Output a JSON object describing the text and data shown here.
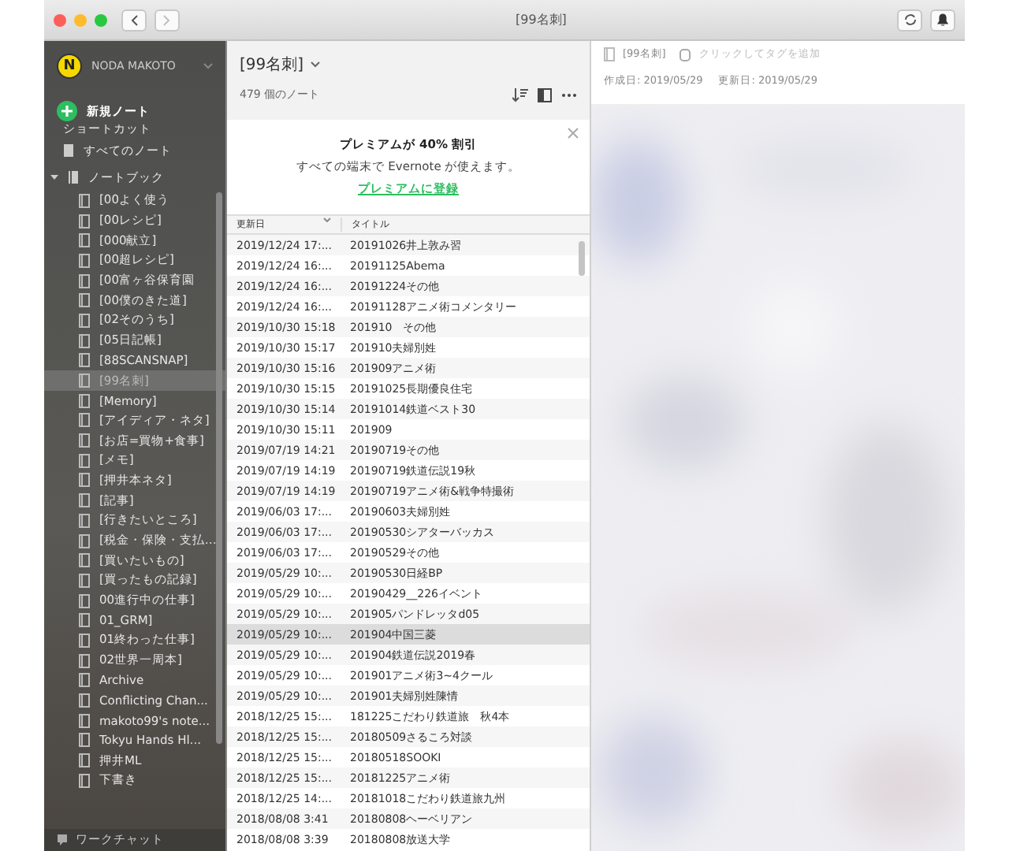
{
  "window": {
    "title": "[99名刺]",
    "back": {
      "disabled": false
    },
    "forward": {
      "disabled": true
    }
  },
  "sidebar": {
    "account": {
      "initial": "N",
      "name": "NODA MAKOTO"
    },
    "new_note": "新規ノート",
    "shortcuts": "ショートカット",
    "all_notes": "すべてのノート",
    "notebooks": {
      "label": "ノートブック",
      "expanded": true,
      "children": [
        {
          "label": "[00よく使う",
          "selected": false
        },
        {
          "label": "[00レシピ]",
          "selected": false
        },
        {
          "label": "[000献立]",
          "selected": false
        },
        {
          "label": "[00超レシピ]",
          "selected": false
        },
        {
          "label": "[00富ヶ谷保育園",
          "selected": false
        },
        {
          "label": "[00僕のきた道]",
          "selected": false
        },
        {
          "label": "[02そのうち]",
          "selected": false
        },
        {
          "label": "[05日記帳]",
          "selected": false
        },
        {
          "label": "[88SCANSNAP]",
          "selected": false
        },
        {
          "label": "[99名刺]",
          "selected": true
        },
        {
          "label": "[Memory]",
          "selected": false
        },
        {
          "label": "[アイディア・ネタ]",
          "selected": false
        },
        {
          "label": "[お店=買物+食事]",
          "selected": false
        },
        {
          "label": "[メモ]",
          "selected": false
        },
        {
          "label": "[押井本ネタ]",
          "selected": false
        },
        {
          "label": "[記事]",
          "selected": false
        },
        {
          "label": "[行きたいところ]",
          "selected": false
        },
        {
          "label": "[税金・保険・支払…",
          "selected": false
        },
        {
          "label": "[買いたいもの]",
          "selected": false
        },
        {
          "label": "[買ったもの記録]",
          "selected": false
        },
        {
          "label": "00進行中の仕事]",
          "selected": false
        },
        {
          "label": "01_GRM]",
          "selected": false
        },
        {
          "label": "01終わった仕事]",
          "selected": false
        },
        {
          "label": "02世界一周本]",
          "selected": false
        },
        {
          "label": "Archive",
          "selected": false
        },
        {
          "label": "Conflicting Chan...",
          "selected": false
        },
        {
          "label": "makoto99's note...",
          "selected": false
        },
        {
          "label": "Tokyu Hands Hl...",
          "selected": false
        },
        {
          "label": "押井ML",
          "selected": false
        },
        {
          "label": "下書き",
          "selected": false
        }
      ]
    },
    "footer": "ワークチャット"
  },
  "note_list": {
    "title": "[99名刺]",
    "count": "479 個のノート",
    "promo": {
      "heading": "プレミアムが 40% 割引",
      "text": "すべての端末で Evernote が使えます。",
      "link": "プレミアムに登録"
    },
    "columns": [
      "更新日",
      "タイトル"
    ],
    "rows": [
      {
        "updated": "2019/12/24 17:...",
        "title": "20191026井上敦み習",
        "selected": false
      },
      {
        "updated": "2019/12/24 16:...",
        "title": "20191125Abema",
        "selected": false
      },
      {
        "updated": "2019/12/24 16:...",
        "title": "20191224その他",
        "selected": false
      },
      {
        "updated": "2019/12/24 16:...",
        "title": "20191128アニメ術コメンタリー",
        "selected": false
      },
      {
        "updated": "2019/10/30 15:18",
        "title": "201910　その他",
        "selected": false
      },
      {
        "updated": "2019/10/30 15:17",
        "title": "201910夫婦別姓",
        "selected": false
      },
      {
        "updated": "2019/10/30 15:16",
        "title": "201909アニメ術",
        "selected": false
      },
      {
        "updated": "2019/10/30 15:15",
        "title": "20191025長期優良住宅",
        "selected": false
      },
      {
        "updated": "2019/10/30 15:14",
        "title": "20191014鉄道ベスト30",
        "selected": false
      },
      {
        "updated": "2019/10/30 15:11",
        "title": "201909",
        "selected": false
      },
      {
        "updated": "2019/07/19 14:21",
        "title": "20190719その他",
        "selected": false
      },
      {
        "updated": "2019/07/19 14:19",
        "title": "20190719鉄道伝説19秋",
        "selected": false
      },
      {
        "updated": "2019/07/19 14:19",
        "title": "20190719アニメ術&戦争特撮術",
        "selected": false
      },
      {
        "updated": "2019/06/03 17:...",
        "title": "20190603夫婦別姓",
        "selected": false
      },
      {
        "updated": "2019/06/03 17:...",
        "title": "20190530シアターバッカス",
        "selected": false
      },
      {
        "updated": "2019/06/03 17:...",
        "title": "20190529その他",
        "selected": false
      },
      {
        "updated": "2019/05/29 10:...",
        "title": "20190530日経BP",
        "selected": false
      },
      {
        "updated": "2019/05/29 10:...",
        "title": "20190429__226イベント",
        "selected": false
      },
      {
        "updated": "2019/05/29 10:...",
        "title": "201905パンドレッタd05",
        "selected": false
      },
      {
        "updated": "2019/05/29 10:...",
        "title": "201904中国三菱",
        "selected": true
      },
      {
        "updated": "2019/05/29 10:...",
        "title": "201904鉄道伝説2019春",
        "selected": false
      },
      {
        "updated": "2019/05/29 10:...",
        "title": "201901アニメ術3~4クール",
        "selected": false
      },
      {
        "updated": "2019/05/29 10:...",
        "title": "201901夫婦別姓陳情",
        "selected": false
      },
      {
        "updated": "2018/12/25 15:...",
        "title": "181225こだわり鉄道旅　秋4本",
        "selected": false
      },
      {
        "updated": "2018/12/25 15:...",
        "title": "20180509さるころ対談",
        "selected": false
      },
      {
        "updated": "2018/12/25 15:...",
        "title": "20180518SOOKI",
        "selected": false
      },
      {
        "updated": "2018/12/25 15:...",
        "title": "20181225アニメ術",
        "selected": false
      },
      {
        "updated": "2018/12/25 14:...",
        "title": "20181018こだわり鉄道旅九州",
        "selected": false
      },
      {
        "updated": "2018/08/08 3:41",
        "title": "20180808ヘーベリアン",
        "selected": false
      },
      {
        "updated": "2018/08/08 3:39",
        "title": "20180808放送大学",
        "selected": false
      }
    ]
  },
  "note": {
    "notebook": "[99名刺]",
    "tag_placeholder": "クリックしてタグを追加",
    "created": "作成日: 2019/05/29",
    "updated": "更新日: 2019/05/29"
  }
}
